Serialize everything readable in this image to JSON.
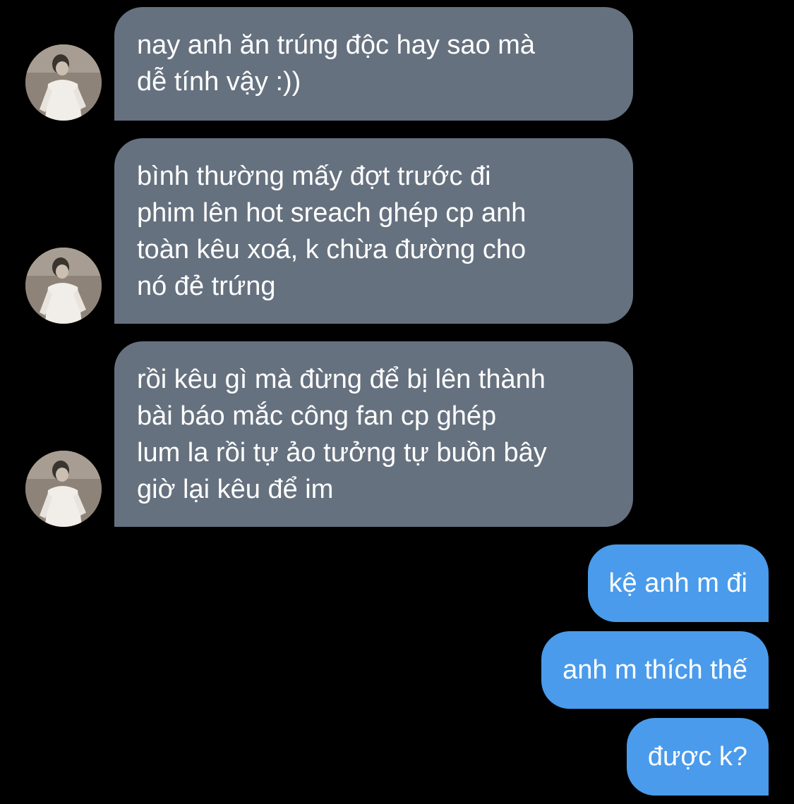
{
  "conversation": {
    "messages": [
      {
        "sender": "other",
        "text": "nay anh ăn trúng độc hay sao mà\ndễ tính vậy :))"
      },
      {
        "sender": "other",
        "text": "bình thường mấy đợt trước đi\nphim lên hot sreach ghép cp anh\ntoàn kêu xoá, k chừa đường cho\nnó đẻ trứng"
      },
      {
        "sender": "other",
        "text": "rồi kêu gì mà đừng để bị lên thành\nbài báo mắc công fan cp ghép\nlum la rồi tự ảo tưởng tự buồn bây\ngiờ lại kêu để im"
      },
      {
        "sender": "me",
        "text": "kệ anh m đi"
      },
      {
        "sender": "me",
        "text": "anh m thích thế"
      },
      {
        "sender": "me",
        "text": "được k?"
      }
    ]
  },
  "colors": {
    "background": "#000000",
    "incoming_bubble": "#66717f",
    "outgoing_bubble": "#4a9beb",
    "text": "#ffffff"
  },
  "icons": {
    "avatar": "contact-avatar-photo"
  }
}
